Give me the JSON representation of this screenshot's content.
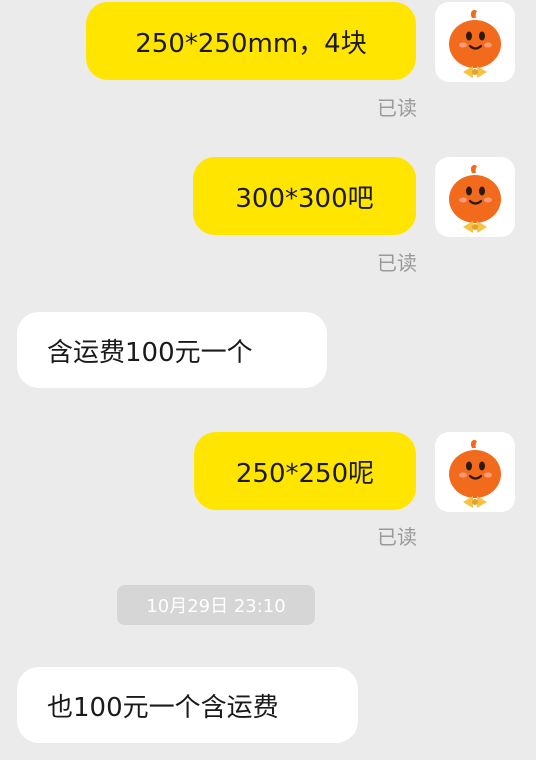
{
  "messages": [
    {
      "text": "250*250mm，4块",
      "status": "已读"
    },
    {
      "text": "300*300吧",
      "status": "已读"
    },
    {
      "text": "含运费100元一个"
    },
    {
      "text": "250*250呢",
      "status": "已读"
    },
    {
      "text": "也100元一个含运费"
    }
  ],
  "timestamp": "10月29日 23:10",
  "colors": {
    "background": "#ebebeb",
    "sent_bubble": "#ffe500",
    "received_bubble": "#ffffff",
    "avatar_orange": "#f26a1b",
    "bow_tie": "#f5c242"
  }
}
